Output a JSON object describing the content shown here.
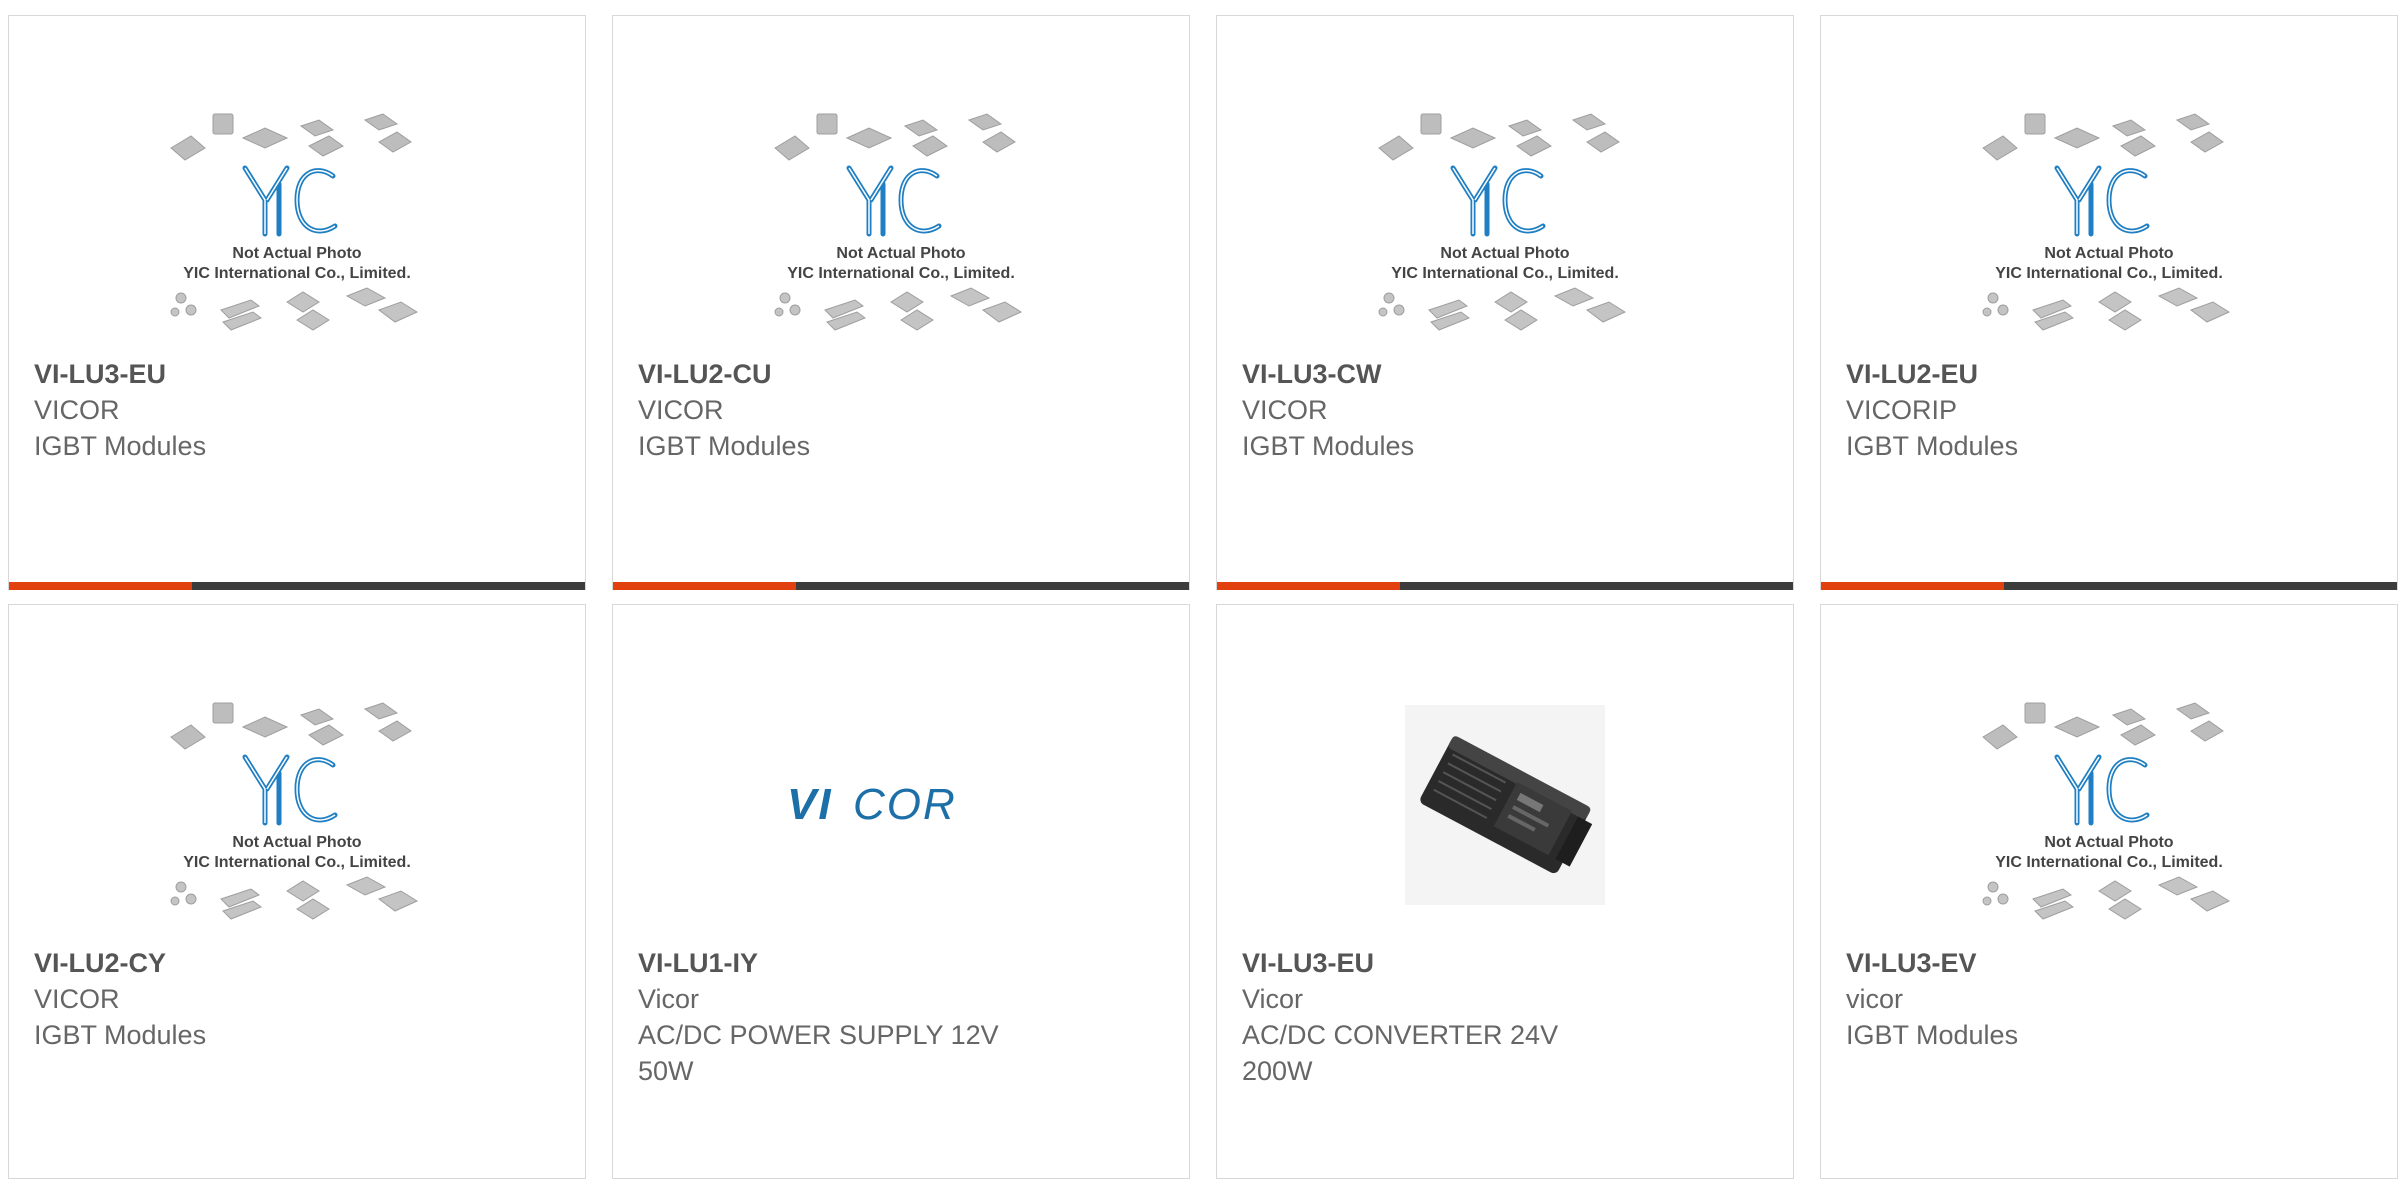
{
  "colors": {
    "accent": "#e2400f",
    "bar": "#3c3c3c",
    "yic_blue": "#1f7fc2",
    "vicor_blue": "#1d6fa8"
  },
  "placeholder_image": {
    "icon": "yic-placeholder-icon",
    "line1": "Not Actual Photo",
    "line2": "YIC International Co., Limited."
  },
  "vicor_logo": {
    "text_bold": "VI",
    "text_rest": "COR"
  },
  "products": [
    {
      "part": "VI-LU3-EU",
      "maker": "VICOR",
      "desc": "IGBT Modules",
      "image": "yic-placeholder",
      "accent_bar": true
    },
    {
      "part": "VI-LU2-CU",
      "maker": "VICOR",
      "desc": "IGBT Modules",
      "image": "yic-placeholder",
      "accent_bar": true
    },
    {
      "part": "VI-LU3-CW",
      "maker": "VICOR",
      "desc": "IGBT Modules",
      "image": "yic-placeholder",
      "accent_bar": true
    },
    {
      "part": "VI-LU2-EU",
      "maker": "VICORIP",
      "desc": "IGBT Modules",
      "image": "yic-placeholder",
      "accent_bar": true
    },
    {
      "part": "VI-LU2-CY",
      "maker": "VICOR",
      "desc": "IGBT Modules",
      "image": "yic-placeholder",
      "accent_bar": false
    },
    {
      "part": "VI-LU1-IY",
      "maker": "Vicor",
      "desc": "AC/DC POWER SUPPLY 12V 50W",
      "image": "vicor-logo",
      "accent_bar": false
    },
    {
      "part": "VI-LU3-EU",
      "maker": "Vicor",
      "desc": "AC/DC CONVERTER 24V 200W",
      "image": "power-supply-photo",
      "accent_bar": false
    },
    {
      "part": "VI-LU3-EV",
      "maker": "vicor",
      "desc": "IGBT Modules",
      "image": "yic-placeholder",
      "accent_bar": false
    }
  ]
}
